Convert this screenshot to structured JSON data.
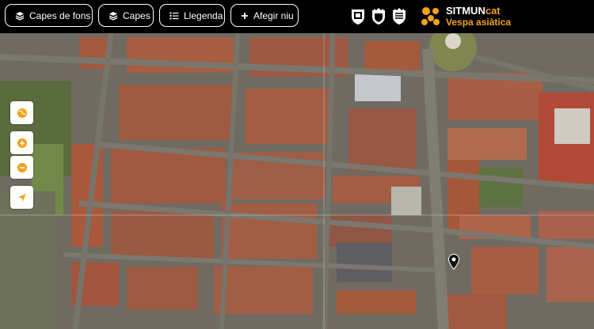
{
  "toolbar": {
    "basemaps_label": "Capes de fons",
    "layers_label": "Capes",
    "legend_label": "Llegenda",
    "add_label": "Afegir niu"
  },
  "brand": {
    "name_main": "SITMUN",
    "name_suffix": "cat",
    "subtitle": "Vespa asiàtica"
  },
  "colors": {
    "accent": "#f4a21b",
    "toolbar_bg": "#000000",
    "control_icon": "#f4a21b"
  },
  "map_controls": [
    "globe-icon",
    "zoom-in-icon",
    "zoom-out-icon",
    "locate-icon"
  ]
}
